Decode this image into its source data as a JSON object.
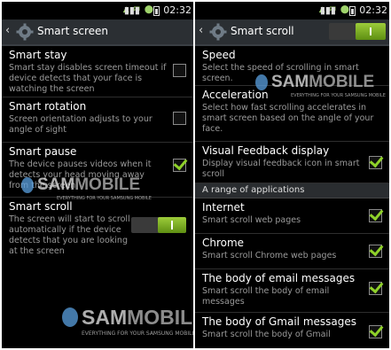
{
  "status_bar": {
    "time": "02:32"
  },
  "left_screen": {
    "title": "Smart screen",
    "items": [
      {
        "title": "Smart stay",
        "summary": "Smart stay disables screen timeout if device detects that your face is watching the screen",
        "checked": false
      },
      {
        "title": "Smart rotation",
        "summary": "Screen orientation adjusts to your angle of sight",
        "checked": false
      },
      {
        "title": "Smart pause",
        "summary": "The device pauses videos when it detects your head moving away from the screen",
        "checked": true
      },
      {
        "title": "Smart scroll",
        "summary": "The screen will start to scroll automatically if the device detects that you are looking at the screen",
        "toggle_on": true
      }
    ]
  },
  "right_screen": {
    "title": "Smart scroll",
    "master_toggle_on": true,
    "items": [
      {
        "title": "Speed",
        "summary": "Select the speed of scrolling in smart screen."
      },
      {
        "title": "Acceleration",
        "summary": "Select how fast scrolling accelerates in smart screen based on the angle of your face."
      },
      {
        "title": "Visual Feedback display",
        "summary": "Display visual feedback icon in smart scroll",
        "checked": true
      }
    ],
    "section_header": "A range of applications",
    "apps": [
      {
        "title": "Internet",
        "summary": "Smart scroll web pages",
        "checked": true
      },
      {
        "title": "Chrome",
        "summary": "Smart scroll Chrome web pages",
        "checked": true
      },
      {
        "title": "The body of email messages",
        "summary": "Smart scroll the body of email messages",
        "checked": true
      },
      {
        "title": "The body of Gmail messages",
        "summary": "Smart scroll the body of Gmail",
        "checked": true
      }
    ]
  },
  "watermark": {
    "brand_a": "SAM",
    "brand_b": "MOBILE",
    "tagline": "EVERYTHING FOR YOUR SAMSUNG MOBILE"
  },
  "colors": {
    "accent_green": "#8fd12a",
    "action_bar": "#2b2f33",
    "background": "#000000"
  }
}
